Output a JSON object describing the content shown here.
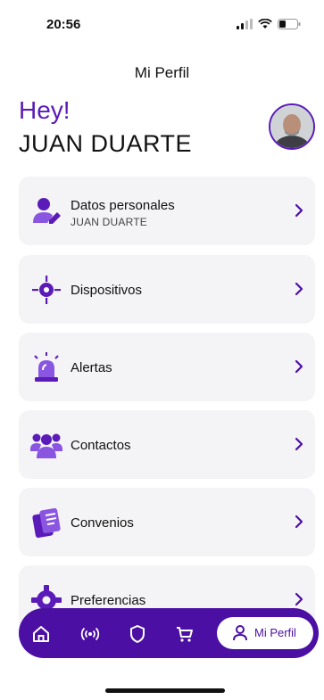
{
  "status_bar": {
    "time": "20:56"
  },
  "header": {
    "title": "Mi Perfil",
    "greeting": "Hey!",
    "user_name": "JUAN DUARTE"
  },
  "menu": {
    "items": [
      {
        "label": "Datos personales",
        "sublabel": "JUAN DUARTE",
        "icon": "user-edit-icon"
      },
      {
        "label": "Dispositivos",
        "icon": "device-target-icon"
      },
      {
        "label": "Alertas",
        "icon": "siren-icon"
      },
      {
        "label": "Contactos",
        "icon": "group-icon"
      },
      {
        "label": "Convenios",
        "icon": "document-icon"
      },
      {
        "label": "Preferencias",
        "icon": "gear-icon"
      }
    ]
  },
  "bottom_nav": {
    "items": [
      {
        "icon": "home-icon"
      },
      {
        "icon": "broadcast-icon"
      },
      {
        "icon": "shield-icon"
      },
      {
        "icon": "cart-icon"
      }
    ],
    "active_label": "Mi Perfil",
    "active_icon": "person-icon"
  },
  "colors": {
    "primary": "#4b0fa3",
    "accent_text": "#5a1bb8",
    "card_bg": "#f4f3f6",
    "icon_purple": "#7a3fd6"
  }
}
